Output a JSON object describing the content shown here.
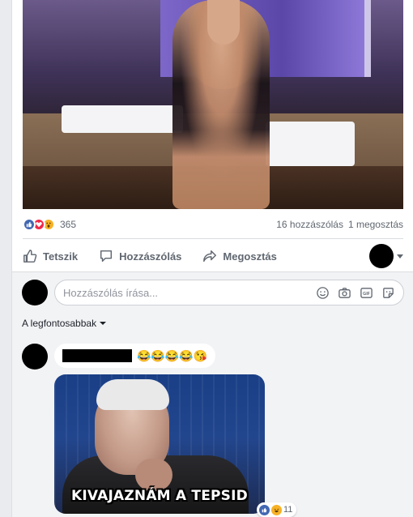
{
  "post": {
    "reactions": {
      "icons": [
        "like-icon",
        "love-icon",
        "wow-icon"
      ],
      "count": "365"
    },
    "comments_count": "16 hozzászólás",
    "shares_count": "1 megosztás"
  },
  "actions": {
    "like": "Tetszik",
    "comment": "Hozzászólás",
    "share": "Megosztás"
  },
  "composer": {
    "placeholder": "Hozzászólás írása...",
    "icons": [
      "emoji-icon",
      "camera-icon",
      "gif-icon",
      "sticker-icon"
    ]
  },
  "sort": {
    "label": "A legfontosabbak"
  },
  "comment": {
    "emojis": "😂😂😂😂😘",
    "meme_caption": "KIVAJAZNÁM A TEPSID",
    "reaction_count": "11"
  },
  "colors": {
    "facebook_blue": "#4267b2",
    "love_red": "#f0284a",
    "wow_yellow": "#f7b125"
  }
}
